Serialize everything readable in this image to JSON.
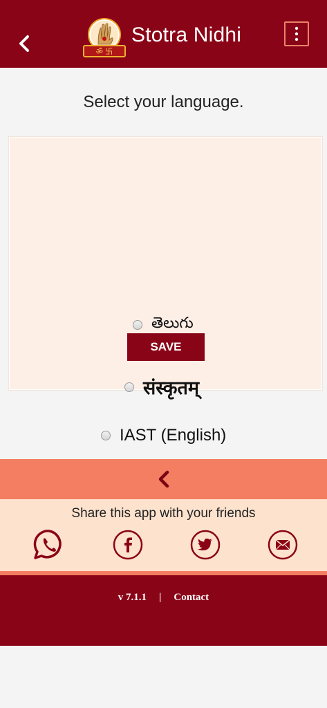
{
  "header": {
    "title": "Stotra Nidhi",
    "logo_caption": "ॐ 卐"
  },
  "prompt": "Select your language.",
  "languages": [
    {
      "label": "తెలుగు",
      "selected": false
    },
    {
      "label": "संस्कृतम्",
      "selected": false
    },
    {
      "label": "IAST (English)",
      "selected": false
    }
  ],
  "save_label": "SAVE",
  "share": {
    "text": "Share this app with your friends",
    "icons": [
      "whatsapp-icon",
      "facebook-icon",
      "twitter-icon",
      "email-icon"
    ]
  },
  "footer": {
    "version": "v 7.1.1",
    "separator": "|",
    "contact": "Contact"
  },
  "colors": {
    "primary": "#8a0417",
    "accent": "#f47e61",
    "card_bg": "#fdeee6",
    "share_bg": "#fde2cd",
    "page_bg": "#f4f4f4"
  }
}
